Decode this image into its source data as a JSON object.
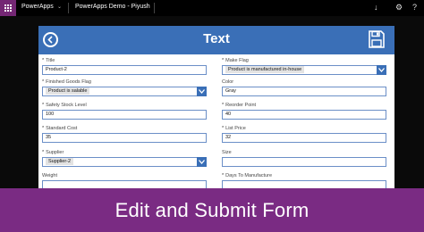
{
  "topbar": {
    "brand": "PowerApps",
    "app_title": "PowerApps Demo - Piyush",
    "icons": [
      "waffle-icon",
      "chevron-down-icon",
      "download-icon",
      "settings-icon",
      "help-icon"
    ]
  },
  "form": {
    "header_title": "Text",
    "left": [
      {
        "label": "Title",
        "value": "Product-2",
        "type": "text"
      },
      {
        "label": "Finished Goods Flag",
        "value": "Product is salable",
        "type": "dropdown"
      },
      {
        "label": "Safety Stock Level",
        "value": "100",
        "type": "text"
      },
      {
        "label": "Standard Cost",
        "value": "35",
        "type": "text"
      },
      {
        "label": "Supplier",
        "value": "Supplier-2",
        "type": "dropdown"
      },
      {
        "label": "Weight",
        "value": "",
        "type": "text"
      }
    ],
    "right": [
      {
        "label": "Make Flag",
        "value": "Product is manufactured in-house",
        "type": "dropdown"
      },
      {
        "label": "Color",
        "value": "Gray",
        "type": "text"
      },
      {
        "label": "Reorder Point",
        "value": "40",
        "type": "text"
      },
      {
        "label": "List Price",
        "value": "32",
        "type": "text"
      },
      {
        "label": "Size",
        "value": "",
        "type": "text"
      },
      {
        "label": "Days To Manufacture",
        "value": "",
        "type": "text"
      }
    ]
  },
  "banner": {
    "text": "Edit and Submit Form"
  },
  "colors": {
    "header": "#3a6fb7",
    "banner": "#7a2b83",
    "waffle": "#742774",
    "field_border": "#6b8fc7"
  }
}
